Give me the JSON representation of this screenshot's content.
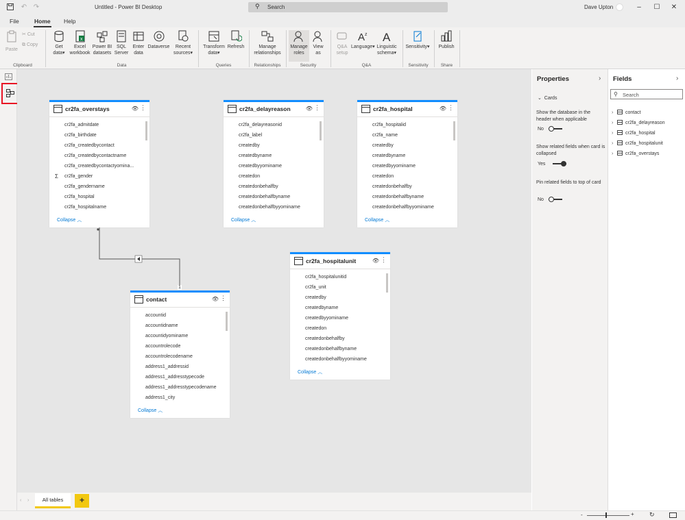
{
  "app": {
    "title": "Untitled - Power BI Desktop",
    "search_placeholder": "Search",
    "user": "Dave Upton"
  },
  "menu": {
    "file": "File",
    "home": "Home",
    "help": "Help"
  },
  "ribbon": {
    "buttons": [
      {
        "label": "Paste"
      },
      {
        "label": "Cut"
      },
      {
        "label": "Copy"
      },
      {
        "label": "Get data"
      },
      {
        "label": "Excel workbook"
      },
      {
        "label": "Power BI datasets"
      },
      {
        "label": "SQL Server"
      },
      {
        "label": "Enter data"
      },
      {
        "label": "Dataverse"
      },
      {
        "label": "Recent sources"
      },
      {
        "label": "Transform data"
      },
      {
        "label": "Refresh"
      },
      {
        "label": "Manage relationships"
      },
      {
        "label": "Manage roles"
      },
      {
        "label": "View as"
      },
      {
        "label": "Q&A setup"
      },
      {
        "label": "Language"
      },
      {
        "label": "Linguistic schema"
      },
      {
        "label": "Sensitivity"
      },
      {
        "label": "Publish"
      }
    ],
    "groups": [
      "Clipboard",
      "Data",
      "Queries",
      "Relationships",
      "Security",
      "Q&A",
      "Sensitivity",
      "Share"
    ]
  },
  "tables": [
    {
      "name": "cr2fa_overstays",
      "collapse": "Collapse",
      "fields": [
        "cr2fa_admitdate",
        "cr2fa_birthdate",
        "cr2fa_createdbycontact",
        "cr2fa_createdbycontactname",
        "cr2fa_createdbycontactyomina...",
        "cr2fa_gender",
        "cr2fa_gendername",
        "cr2fa_hospital",
        "cr2fa_hospitalname"
      ]
    },
    {
      "name": "cr2fa_delayreason",
      "collapse": "Collapse",
      "fields": [
        "cr2fa_delayreasonid",
        "cr2fa_label",
        "createdby",
        "createdbyname",
        "createdbyyominame",
        "createdon",
        "createdonbehalfby",
        "createdonbehalfbyname",
        "createdonbehalfbyyominame"
      ]
    },
    {
      "name": "cr2fa_hospital",
      "collapse": "Collapse",
      "fields": [
        "cr2fa_hospitalid",
        "cr2fa_name",
        "createdby",
        "createdbyname",
        "createdbyyominame",
        "createdon",
        "createdonbehalfby",
        "createdonbehalfbyname",
        "createdonbehalfbyyominame"
      ]
    },
    {
      "name": "cr2fa_hospitalunit",
      "collapse": "Collapse",
      "fields": [
        "cr2fa_hospitalunitid",
        "cr2fa_unit",
        "createdby",
        "createdbyname",
        "createdbyyominame",
        "createdon",
        "createdonbehalfby",
        "createdonbehalfbyname",
        "createdonbehalfbyyominame"
      ]
    },
    {
      "name": "contact",
      "collapse": "Collapse",
      "fields": [
        "accountid",
        "accountidname",
        "accountidyominame",
        "accountrolecode",
        "accountrolecodename",
        "address1_addressid",
        "address1_addresstypecode",
        "address1_addresstypecodename",
        "address1_city"
      ]
    }
  ],
  "relationship": {
    "from_cardinality": "*",
    "to_cardinality": "1"
  },
  "properties": {
    "title": "Properties",
    "section": "Cards",
    "opt1": {
      "label": "Show the database in the header when applicable",
      "value": "No",
      "on": false
    },
    "opt2": {
      "label": "Show related fields when card is collapsed",
      "value": "Yes",
      "on": true
    },
    "opt3": {
      "label": "Pin related fields to top of card",
      "value": "No",
      "on": false
    }
  },
  "fields_pane": {
    "title": "Fields",
    "search_placeholder": "Search",
    "items": [
      "contact",
      "cr2fa_delayreason",
      "cr2fa_hospital",
      "cr2fa_hospitalunit",
      "cr2fa_overstays"
    ]
  },
  "bottom": {
    "tab": "All tables",
    "add": "+"
  },
  "colors": {
    "accent": "#118dff",
    "link": "#0078d4",
    "highlight": "#e81123",
    "add_tab": "#f2c811"
  }
}
